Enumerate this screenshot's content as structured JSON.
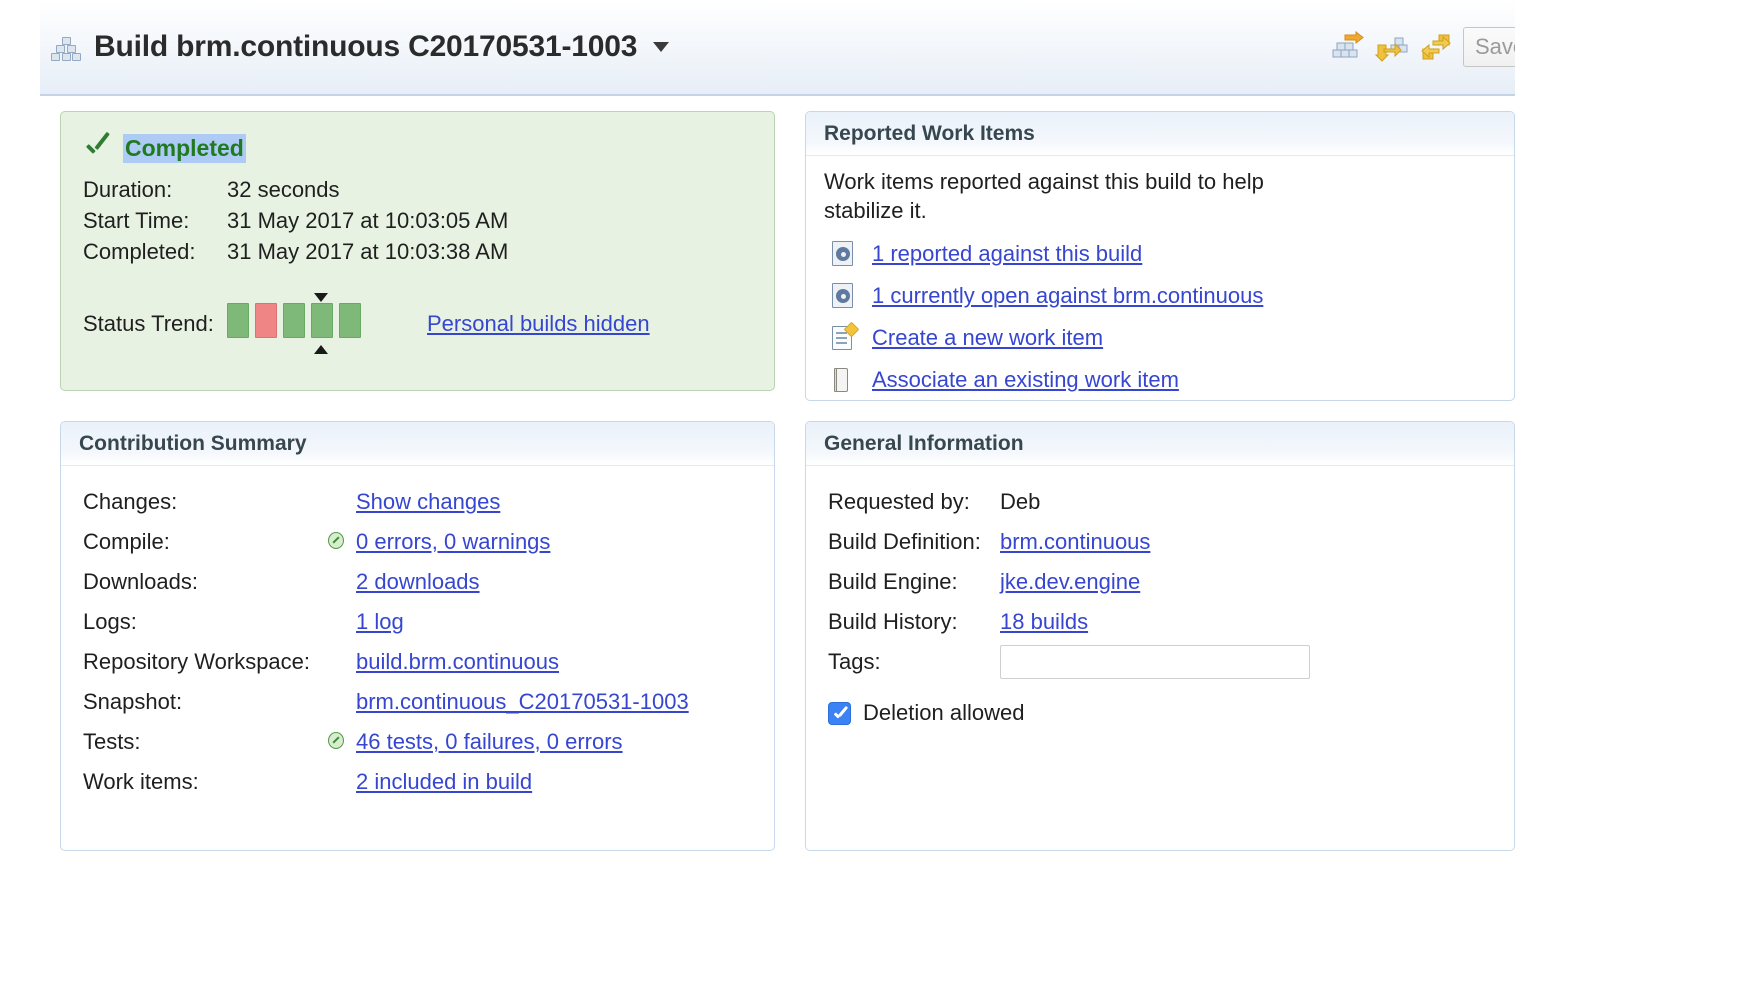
{
  "header": {
    "icon": "build-stack-icon",
    "title": "Build brm.continuous C20170531-1003",
    "caret": "chevron-down-icon",
    "tools": [
      {
        "name": "request-build-icon",
        "label": "Request Build"
      },
      {
        "name": "fetch-build-icon",
        "label": "Fetch Build"
      },
      {
        "name": "refresh-icon",
        "label": "Refresh"
      }
    ],
    "save_label": "Save"
  },
  "status_panel": {
    "state_icon": "checkmark-icon",
    "state": "Completed",
    "rows": [
      {
        "label": "Duration:",
        "value": "32 seconds"
      },
      {
        "label": "Start Time:",
        "value": "31 May 2017 at 10:03:05 AM"
      },
      {
        "label": "Completed:",
        "value": "31 May 2017 at 10:03:38 AM"
      }
    ],
    "trend_label": "Status Trend:",
    "trend_bars": [
      "green",
      "red",
      "green",
      "green",
      "green"
    ],
    "trend_current_index": 3,
    "personal_builds_link": "Personal builds hidden"
  },
  "work_items": {
    "title": "Reported Work Items",
    "description": "Work items reported against this build to help stabilize it.",
    "links": [
      {
        "icon": "work-item-icon",
        "label": "1 reported against this build"
      },
      {
        "icon": "work-item-icon",
        "label": "1 currently open against brm.continuous"
      },
      {
        "icon": "new-work-item-icon",
        "label": "Create a new work item"
      },
      {
        "icon": "associate-work-item-icon",
        "label": "Associate an existing work item"
      }
    ]
  },
  "contribution": {
    "title": "Contribution Summary",
    "rows": [
      {
        "label": "Changes:",
        "status": "",
        "value": "Show changes",
        "link": true
      },
      {
        "label": "Compile:",
        "status": "ok",
        "value": "0 errors, 0 warnings",
        "link": true
      },
      {
        "label": "Downloads:",
        "status": "",
        "value": "2 downloads",
        "link": true
      },
      {
        "label": "Logs:",
        "status": "",
        "value": "1 log",
        "link": true
      },
      {
        "label": "Repository Workspace:",
        "status": "",
        "value": "build.brm.continuous",
        "link": true
      },
      {
        "label": "Snapshot:",
        "status": "",
        "value": "brm.continuous_C20170531-1003",
        "link": true
      },
      {
        "label": "Tests:",
        "status": "ok",
        "value": "46 tests, 0 failures, 0 errors",
        "link": true
      },
      {
        "label": "Work items:",
        "status": "",
        "value": "2 included in build",
        "link": true
      }
    ]
  },
  "general": {
    "title": "General Information",
    "rows": [
      {
        "label": "Requested by:",
        "value": "Deb",
        "link": false
      },
      {
        "label": "Build Definition:",
        "value": "brm.continuous",
        "link": true
      },
      {
        "label": "Build Engine:",
        "value": "jke.dev.engine",
        "link": true
      },
      {
        "label": "Build History:",
        "value": "18 builds",
        "link": true
      }
    ],
    "tags_label": "Tags:",
    "tags_value": "",
    "tags_placeholder": "",
    "deletion_label": "Deletion allowed",
    "deletion_checked": true
  },
  "colors": {
    "link": "#3646d0",
    "success_green": "#207a20",
    "panel_green_bg": "#e8f2e3",
    "trend_green": "#7fb97a",
    "trend_red": "#ef8585",
    "checkbox_blue": "#3b82f6",
    "selection_blue": "#aecbf5"
  }
}
